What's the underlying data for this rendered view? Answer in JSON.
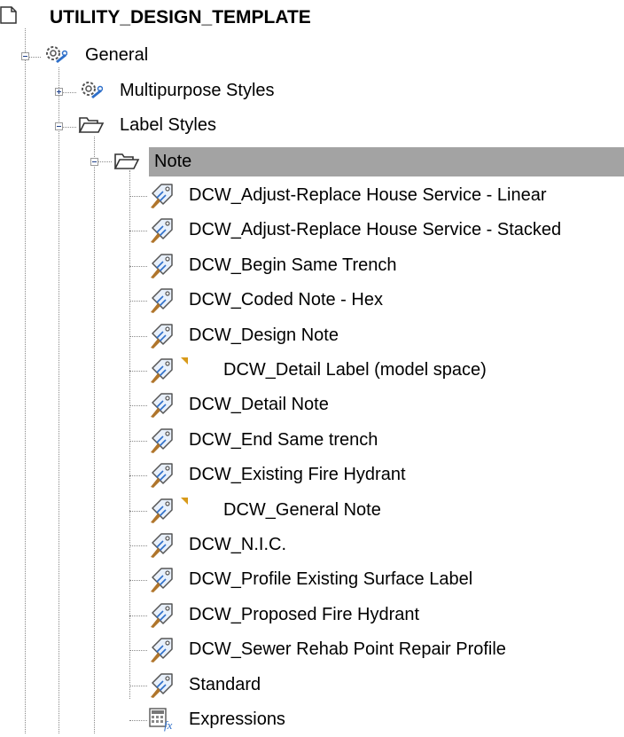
{
  "tree": {
    "root": {
      "label": "UTILITY_DESIGN_TEMPLATE",
      "icon": "page-icon"
    },
    "general": {
      "label": "General",
      "icon": "gear-wrench-icon",
      "expanded": true
    },
    "multipurpose": {
      "label": "Multipurpose Styles",
      "icon": "gear-wrench-icon",
      "expanded": false
    },
    "label_styles": {
      "label": "Label Styles",
      "icon": "folder-open-icon",
      "expanded": true
    },
    "note": {
      "label": "Note",
      "icon": "folder-open-icon",
      "expanded": true,
      "selected": true
    },
    "note_items": [
      {
        "label": "DCW_Adjust-Replace House Service - Linear"
      },
      {
        "label": "DCW_Adjust-Replace House Service - Stacked"
      },
      {
        "label": "DCW_Begin Same Trench"
      },
      {
        "label": "DCW_Coded Note - Hex"
      },
      {
        "label": "DCW_Design Note"
      },
      {
        "label": "DCW_Detail Label (model space)",
        "flagged": true
      },
      {
        "label": "DCW_Detail Note"
      },
      {
        "label": "DCW_End Same trench"
      },
      {
        "label": "DCW_Existing Fire Hydrant"
      },
      {
        "label": "DCW_General Note",
        "flagged": true
      },
      {
        "label": "DCW_N.I.C."
      },
      {
        "label": "DCW_Profile Existing Surface Label"
      },
      {
        "label": "DCW_Proposed Fire Hydrant"
      },
      {
        "label": "DCW_Sewer Rehab Point Repair Profile"
      },
      {
        "label": "Standard"
      }
    ],
    "expressions": {
      "label": "Expressions",
      "icon": "expressions-icon"
    },
    "colors": {
      "flag": "#d89a1a",
      "selection": "#a3a3a3",
      "connector": "#8a8a8a"
    }
  }
}
